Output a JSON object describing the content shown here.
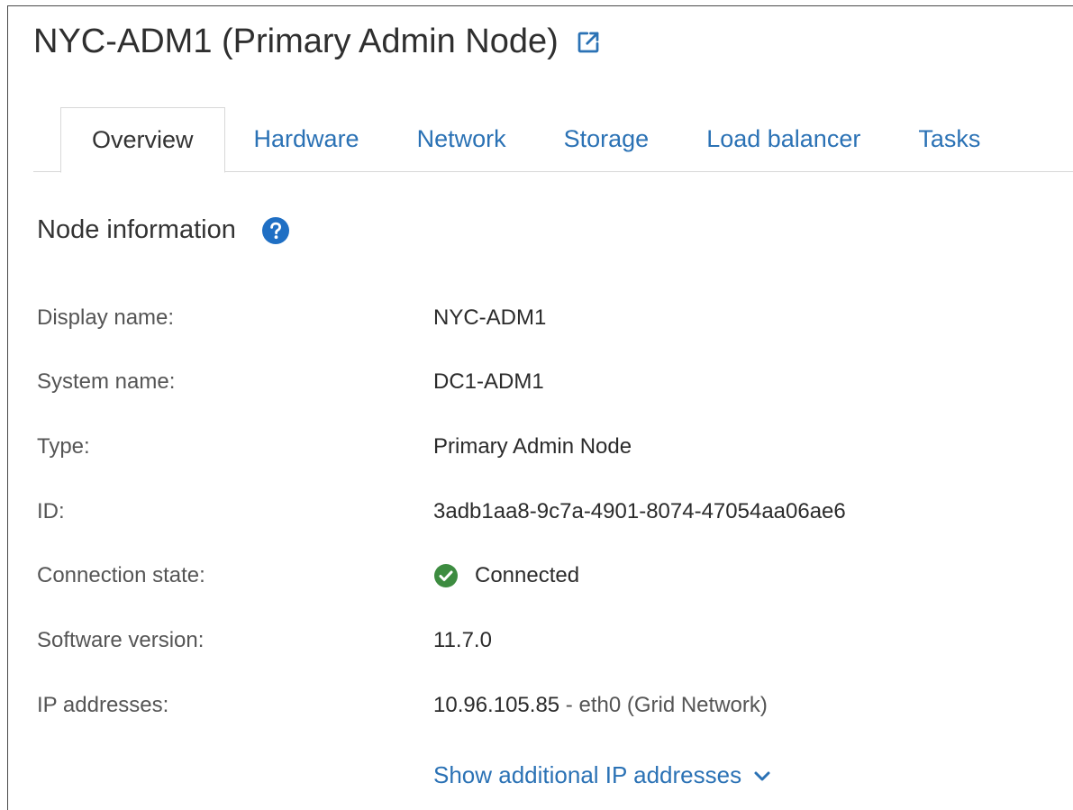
{
  "header": {
    "title": "NYC-ADM1 (Primary Admin Node)",
    "external_link_icon": "external-link-icon"
  },
  "tabs": [
    {
      "label": "Overview",
      "active": true
    },
    {
      "label": "Hardware",
      "active": false
    },
    {
      "label": "Network",
      "active": false
    },
    {
      "label": "Storage",
      "active": false
    },
    {
      "label": "Load balancer",
      "active": false
    },
    {
      "label": "Tasks",
      "active": false
    }
  ],
  "section": {
    "title": "Node information",
    "help_icon": "help-circle-icon"
  },
  "info": {
    "display_name": {
      "label": "Display name:",
      "value": "NYC-ADM1"
    },
    "system_name": {
      "label": "System name:",
      "value": "DC1-ADM1"
    },
    "type": {
      "label": "Type:",
      "value": "Primary Admin Node"
    },
    "id": {
      "label": "ID:",
      "value": "3adb1aa8-9c7a-4901-8074-47054aa06ae6"
    },
    "connection_state": {
      "label": "Connection state:",
      "value": "Connected",
      "icon": "check-circle-icon"
    },
    "software_version": {
      "label": "Software version:",
      "value": "11.7.0"
    },
    "ip_addresses": {
      "label": "IP addresses:",
      "ip": "10.96.105.85",
      "suffix": " - eth0 (Grid Network)"
    }
  },
  "show_more": {
    "label": "Show additional IP addresses",
    "icon": "chevron-down-icon"
  },
  "colors": {
    "link": "#2b72b5",
    "help_icon": "#1f6fc4",
    "success": "#3d8c40",
    "text": "#323232"
  }
}
